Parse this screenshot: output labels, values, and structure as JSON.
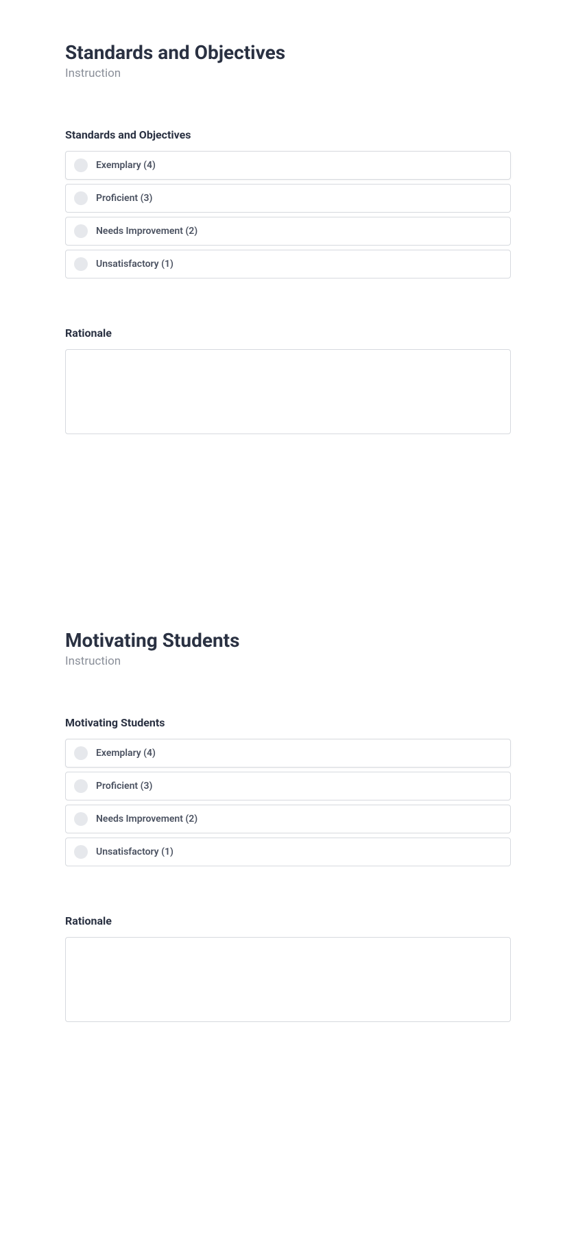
{
  "sections": [
    {
      "title": "Standards and Objectives",
      "subtitle": "Instruction",
      "question_label": "Standards and Objectives",
      "options": [
        {
          "label": "Exemplary (4)"
        },
        {
          "label": "Proficient (3)"
        },
        {
          "label": "Needs Improvement (2)"
        },
        {
          "label": "Unsatisfactory (1)"
        }
      ],
      "rationale_label": "Rationale",
      "rationale_value": ""
    },
    {
      "title": "Motivating Students",
      "subtitle": "Instruction",
      "question_label": "Motivating Students",
      "options": [
        {
          "label": "Exemplary (4)"
        },
        {
          "label": "Proficient (3)"
        },
        {
          "label": "Needs Improvement (2)"
        },
        {
          "label": "Unsatisfactory (1)"
        }
      ],
      "rationale_label": "Rationale",
      "rationale_value": ""
    }
  ]
}
